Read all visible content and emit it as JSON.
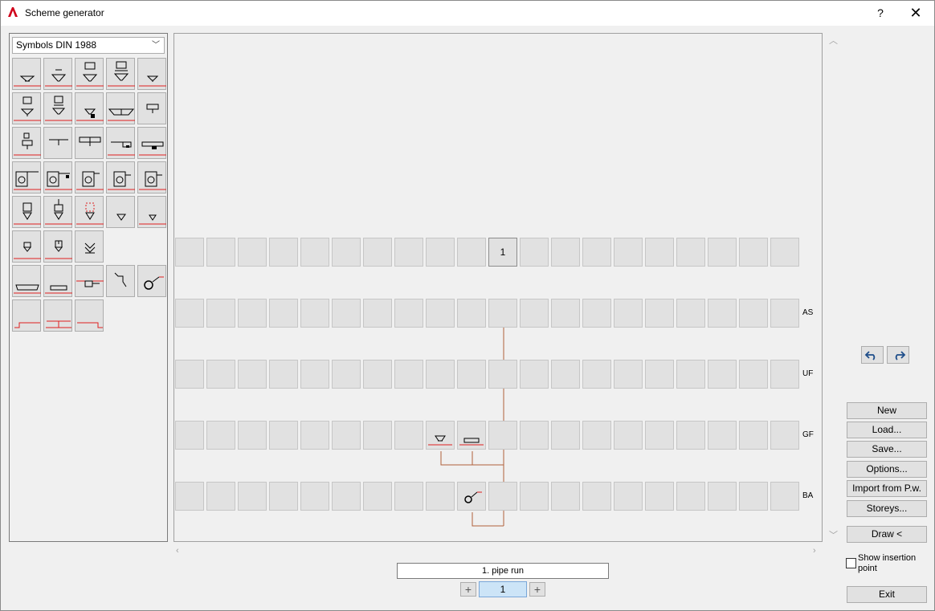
{
  "window": {
    "title": "Scheme generator",
    "help": "?",
    "close": "✕"
  },
  "palette": {
    "symbol_set": "Symbols DIN 1988"
  },
  "grid": {
    "header_row_number": "1",
    "storeys": [
      "AS",
      "UF",
      "GF",
      "BA"
    ]
  },
  "buttons": {
    "new": "New",
    "load": "Load...",
    "save": "Save...",
    "options": "Options...",
    "import": "Import from P.w.",
    "storeys": "Storeys...",
    "draw": "Draw <",
    "exit": "Exit"
  },
  "checkbox": {
    "label": "Show insertion point",
    "checked": false
  },
  "pipe_run": {
    "value": "1. pipe run"
  },
  "page": {
    "value": "1",
    "minus": "+",
    "plus": "+"
  },
  "colors": {
    "pipe": "#b0603a",
    "red_line": "#e02020",
    "cell": "#e1e1e1"
  }
}
